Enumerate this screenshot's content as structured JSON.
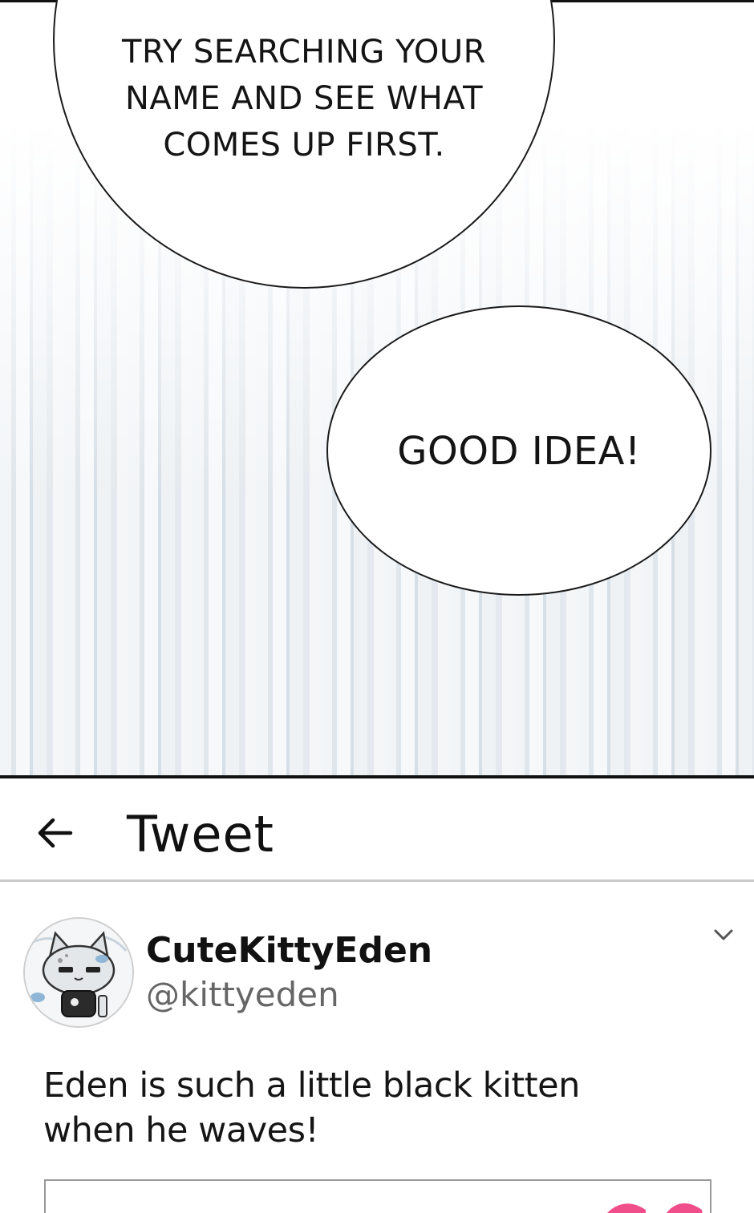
{
  "comic": {
    "bubble_1_text": "TRY SEARCHING YOUR NAME AND SEE WHAT COMES UP FIRST.",
    "bubble_2_text": "GOOD IDEA!"
  },
  "tweet_screen": {
    "header": {
      "back_icon": "arrow-left-icon",
      "title": "Tweet"
    },
    "author": {
      "display_name": "CuteKittyEden",
      "handle": "@kittyeden",
      "avatar_icon": "cat-avatar",
      "menu_icon": "chevron-down-icon"
    },
    "text": "Eden is such a little black kitten when he waves!"
  },
  "colors": {
    "panel_stripes": "#dfe6ec",
    "divider": "#c9c9c9",
    "handle_text": "#666666",
    "accent_pink": "#f04e8a"
  }
}
